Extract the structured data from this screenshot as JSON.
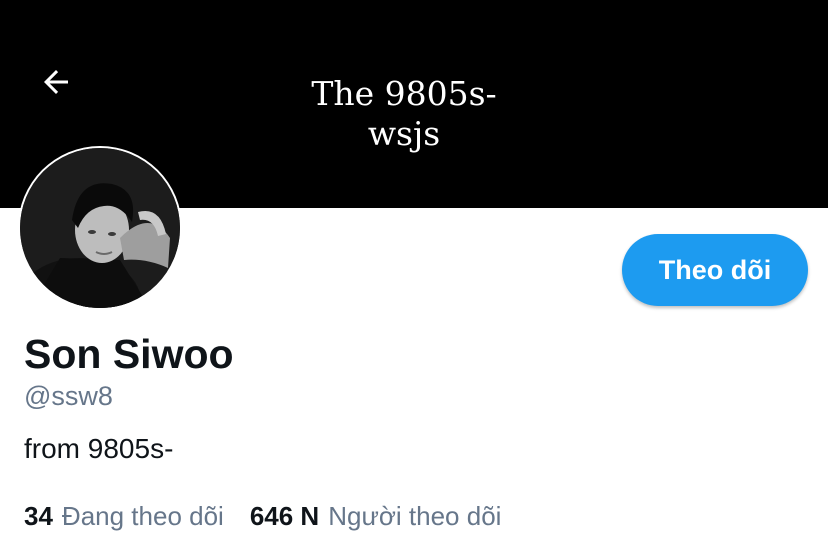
{
  "header": {
    "back_icon": "arrow-left-icon",
    "banner_line1": "The 9805s-",
    "banner_line2": "wsjs"
  },
  "profile": {
    "name": "Son Siwoo",
    "handle": "@ssw8",
    "bio": "from 9805s-",
    "follow_label": "Theo dõi"
  },
  "stats": {
    "following_count": "34",
    "following_label": "Đang theo dõi",
    "followers_count": "646 N",
    "followers_label": "Người theo dõi"
  },
  "colors": {
    "banner": "#000000",
    "accent": "#1d9bf0",
    "text_primary": "#0f1419",
    "text_secondary": "#66768a"
  }
}
